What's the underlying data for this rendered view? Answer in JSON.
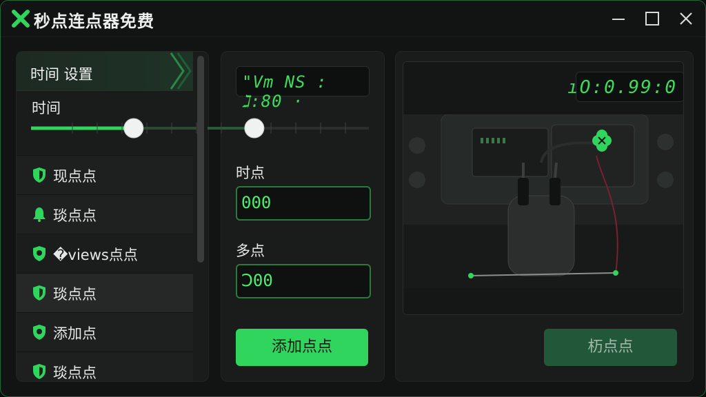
{
  "window": {
    "title": "秒点连点器免费",
    "controls": [
      "minimize-icon",
      "maximize-icon",
      "close-icon"
    ]
  },
  "left_panel": {
    "section_header": "时间 设置",
    "time_label": "时间",
    "slider_value": 0.62,
    "items": [
      {
        "label": "现点点",
        "icon": "shield-icon"
      },
      {
        "label": "琰点点",
        "icon": "bell-icon"
      },
      {
        "label": "�views点点",
        "icon": "shield-icon"
      },
      {
        "label": "琰点点",
        "icon": "shield-icon"
      },
      {
        "label": "添加点",
        "icon": "shield-icon"
      },
      {
        "label": "琰点点",
        "icon": "shield-icon"
      }
    ]
  },
  "middle_panel": {
    "lcd_text": "\"Vm NS : ℷ:80 ·",
    "slider_value": 0.29,
    "field1_label": "时点",
    "field1_value": "000",
    "field2_label": "多点",
    "field2_value": "Ↄ00",
    "add_button": "添加点点"
  },
  "right_panel": {
    "lcd_text": "ıO:0.99:0",
    "secondary_button": "杤点点"
  },
  "colors": {
    "accent": "#2fd55c",
    "lcd_green": "#3ddc5c",
    "panel_bg": "#1a1c1b",
    "window_bg": "#121413"
  }
}
